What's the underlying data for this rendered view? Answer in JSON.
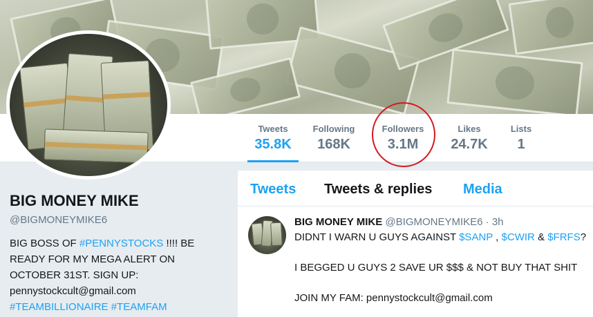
{
  "colors": {
    "accent": "#1da1f2",
    "muted": "#657786",
    "annotation": "#d6181f"
  },
  "stats": [
    {
      "label": "Tweets",
      "value": "35.8K"
    },
    {
      "label": "Following",
      "value": "168K"
    },
    {
      "label": "Followers",
      "value": "3.1M"
    },
    {
      "label": "Likes",
      "value": "24.7K"
    },
    {
      "label": "Lists",
      "value": "1"
    }
  ],
  "profile": {
    "name": "BIG MONEY MIKE",
    "handle": "@BIGMONEYMIKE6",
    "bio": {
      "p1": "BIG BOSS OF ",
      "tag1": "#PENNYSTOCKS",
      "p2": " !!!! BE READY FOR MY MEGA ALERT ON OCTOBER 31ST. SIGN UP: pennystockcult@gmail.com ",
      "tag2": "#TEAMBILLIONAIRE",
      "p3": " ",
      "tag3": "#TEAMFAM"
    }
  },
  "tabs": [
    "Tweets",
    "Tweets & replies",
    "Media"
  ],
  "tweet": {
    "name": "BIG MONEY MIKE",
    "meta": "@BIGMONEYMIKE6 · 3h",
    "line1_a": "DIDNT I WARN U GUYS AGAINST ",
    "cash1": "$SANP",
    "line1_b": " , ",
    "cash2": "$CWIR",
    "line1_c": " & ",
    "cash3": "$FRFS",
    "line1_d": "?",
    "line2": "I BEGGED U GUYS 2 SAVE UR $$$ & NOT BUY THAT SHIT",
    "line3": "JOIN MY FAM: pennystockcult@gmail.com"
  }
}
